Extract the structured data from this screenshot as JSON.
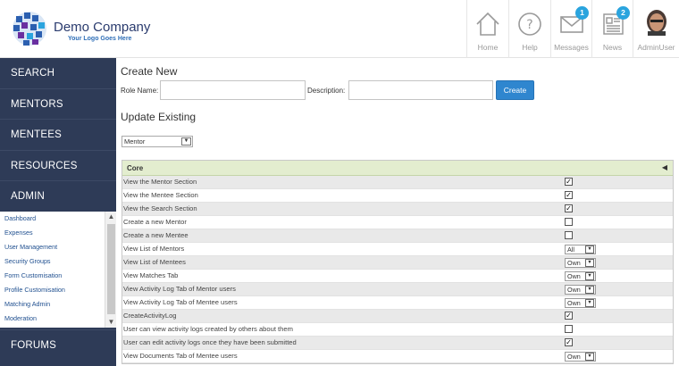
{
  "header": {
    "company": "Demo Company",
    "tagline": "Your Logo Goes Here",
    "nav": [
      {
        "label": "Home",
        "icon": "home-icon",
        "badge": ""
      },
      {
        "label": "Help",
        "icon": "help-icon",
        "badge": ""
      },
      {
        "label": "Messages",
        "icon": "envelope-icon",
        "badge": "1"
      },
      {
        "label": "News",
        "icon": "newspaper-icon",
        "badge": "2"
      },
      {
        "label": "AdminUser",
        "icon": "avatar",
        "badge": ""
      }
    ]
  },
  "sidebar": {
    "main": [
      "SEARCH",
      "MENTORS",
      "MENTEES",
      "RESOURCES",
      "ADMIN"
    ],
    "sub": [
      "Dashboard",
      "Expenses",
      "User Management",
      "Security Groups",
      "Form Customisation",
      "Profile Customisation",
      "Matching Admin",
      "Moderation"
    ],
    "forums": "FORUMS"
  },
  "create": {
    "heading": "Create New",
    "role_label": "Role Name:",
    "role_value": "",
    "desc_label": "Description:",
    "desc_value": "",
    "button": "Create"
  },
  "update": {
    "heading": "Update Existing",
    "selected_role": "Mentor"
  },
  "permissions": {
    "section": "Core",
    "rows": [
      {
        "name": "View the Mentor Section",
        "type": "check",
        "checked": true
      },
      {
        "name": "View the Mentee Section",
        "type": "check",
        "checked": true
      },
      {
        "name": "View the Search Section",
        "type": "check",
        "checked": true
      },
      {
        "name": "Create a new Mentor",
        "type": "check",
        "checked": false
      },
      {
        "name": "Create a new Mentee",
        "type": "check",
        "checked": false
      },
      {
        "name": "View List of Mentors",
        "type": "select",
        "value": "All"
      },
      {
        "name": "View List of Mentees",
        "type": "select",
        "value": "Own"
      },
      {
        "name": "View Matches Tab",
        "type": "select",
        "value": "Own"
      },
      {
        "name": "View Activity Log Tab of Mentor users",
        "type": "select",
        "value": "Own"
      },
      {
        "name": "View Activity Log Tab of Mentee users",
        "type": "select",
        "value": "Own"
      },
      {
        "name": "CreateActivityLog",
        "type": "check",
        "checked": true
      },
      {
        "name": "User can view activity logs created by others about them",
        "type": "check",
        "checked": false
      },
      {
        "name": "User can edit activity logs once they have been submitted",
        "type": "check",
        "checked": true
      },
      {
        "name": "View Documents Tab of Mentee users",
        "type": "select",
        "value": "Own"
      }
    ]
  },
  "colors": {
    "sidebar": "#2e3b57",
    "accent": "#2f86cf",
    "badge": "#2aa4de",
    "section_header": "#e3edcf"
  }
}
